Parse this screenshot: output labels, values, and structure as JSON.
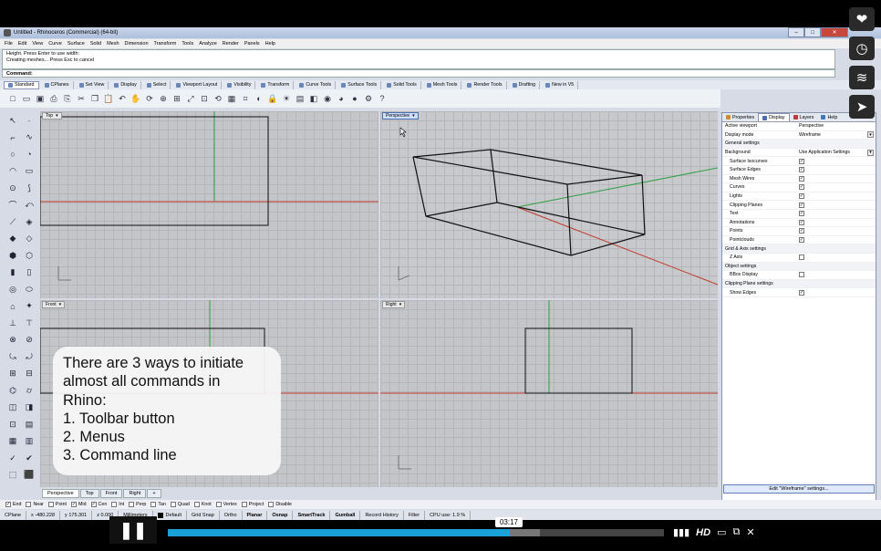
{
  "window": {
    "title": "Untitled - Rhinoceros (Commercial) (64-bit)",
    "buttons": [
      "–",
      "□",
      "✕"
    ]
  },
  "menu": [
    "File",
    "Edit",
    "View",
    "Curve",
    "Surface",
    "Solid",
    "Mesh",
    "Dimension",
    "Transform",
    "Tools",
    "Analyze",
    "Render",
    "Panels",
    "Help"
  ],
  "command_history": [
    "Height. Press Enter to use width:",
    "Creating meshes... Press Esc to cancel"
  ],
  "command_prompt": "Command:",
  "toolbar_tabs": [
    {
      "label": "Standard",
      "active": true
    },
    {
      "label": "CPlanes"
    },
    {
      "label": "Set View"
    },
    {
      "label": "Display"
    },
    {
      "label": "Select"
    },
    {
      "label": "Viewport Layout"
    },
    {
      "label": "Visibility"
    },
    {
      "label": "Transform"
    },
    {
      "label": "Curve Tools"
    },
    {
      "label": "Surface Tools"
    },
    {
      "label": "Solid Tools"
    },
    {
      "label": "Mesh Tools"
    },
    {
      "label": "Render Tools"
    },
    {
      "label": "Drafting"
    },
    {
      "label": "New in V5"
    }
  ],
  "toolbar_icons": [
    "new-icon",
    "open-icon",
    "save-icon",
    "print-icon",
    "import-icon",
    "cut-icon",
    "copy-icon",
    "paste-icon",
    "undo-icon",
    "pan-icon",
    "rotate-icon",
    "zoom-icon",
    "zoom-window-icon",
    "zoom-extents-icon",
    "zoom-selected-icon",
    "redraw-icon",
    "four-viewports-icon",
    "cplane-icon",
    "hide-icon",
    "lock-icon",
    "light-icon",
    "layer-icon",
    "material-icon",
    "color-icon",
    "render-icon",
    "sphere-icon",
    "options-icon",
    "help-icon"
  ],
  "toolbar_glyphs": [
    "□",
    "▭",
    "▣",
    "⎙",
    "⎘",
    "✂",
    "❐",
    "📋",
    "↶",
    "✋",
    "⟳",
    "⊕",
    "⊞",
    "⤢",
    "⊡",
    "⟲",
    "▦",
    "⌗",
    "◐",
    "🔒",
    "☀",
    "▤",
    "◧",
    "◉",
    "◕",
    "●",
    "⚙",
    "?"
  ],
  "left_tool_glyphs": [
    "↖",
    "·",
    "⌐",
    "∿",
    "○",
    "◔",
    "◠",
    "▭",
    "⊙",
    "⟆",
    "⌒",
    "⤺",
    "⟋",
    "◈",
    "◆",
    "◇",
    "⬢",
    "⬡",
    "▮",
    "▯",
    "◎",
    "⬭",
    "⌂",
    "✦",
    "⊥",
    "⊤",
    "⊗",
    "⊘",
    "⤿",
    "⤾",
    "⊞",
    "⊟",
    "⌬",
    "⌭",
    "◫",
    "◨",
    "⊡",
    "▤",
    "▦",
    "▥",
    "✓",
    "✔",
    "⬚",
    "⬛"
  ],
  "viewports": {
    "top": {
      "label": "Top"
    },
    "perspective": {
      "label": "Perspective"
    },
    "front": {
      "label": "Front"
    },
    "right": {
      "label": "Right"
    }
  },
  "viewport_tabs": [
    "Perspective",
    "Top",
    "Front",
    "Right",
    "+"
  ],
  "panel": {
    "tabs": [
      "Properties",
      "Display",
      "Layers",
      "Help"
    ],
    "rows": [
      {
        "key": "Active viewport",
        "value": "Perspective"
      },
      {
        "key": "Display mode",
        "value": "Wireframe",
        "dropdown": true
      },
      {
        "key": "General settings",
        "section": true
      },
      {
        "key": "Background",
        "value": "Use Application Settings",
        "dropdown": true
      },
      {
        "key": "Surface Isocurves",
        "check": true,
        "sub": true
      },
      {
        "key": "Surface Edges",
        "check": true,
        "sub": true
      },
      {
        "key": "Mesh Wires",
        "check": true,
        "sub": true
      },
      {
        "key": "Curves",
        "check": true,
        "sub": true
      },
      {
        "key": "Lights",
        "check": true,
        "sub": true
      },
      {
        "key": "Clipping Planes",
        "check": true,
        "sub": true
      },
      {
        "key": "Text",
        "check": true,
        "sub": true
      },
      {
        "key": "Annotations",
        "check": true,
        "sub": true
      },
      {
        "key": "Points",
        "check": true,
        "sub": true
      },
      {
        "key": "Pointclouds",
        "check": true,
        "sub": true
      },
      {
        "key": "Grid & Axis settings",
        "section": true
      },
      {
        "key": "Z Axis",
        "check": false,
        "sub": true
      },
      {
        "key": "Object settings",
        "section": true
      },
      {
        "key": "BBox Display",
        "check": false,
        "sub": true
      },
      {
        "key": "Clipping Plane settings",
        "section": true
      },
      {
        "key": "Show Edges",
        "check": true,
        "sub": true
      }
    ],
    "edit_button": "Edit \"Wireframe\" settings..."
  },
  "osnaps": [
    {
      "label": "End",
      "checked": true
    },
    {
      "label": "Near",
      "checked": false
    },
    {
      "label": "Point",
      "checked": false
    },
    {
      "label": "Mid",
      "checked": true
    },
    {
      "label": "Cen",
      "checked": true
    },
    {
      "label": "Int",
      "checked": false
    },
    {
      "label": "Perp",
      "checked": false
    },
    {
      "label": "Tan",
      "checked": false
    },
    {
      "label": "Quad",
      "checked": false
    },
    {
      "label": "Knot",
      "checked": false
    },
    {
      "label": "Vertex",
      "checked": false
    },
    {
      "label": "Project",
      "checked": false
    },
    {
      "label": "Disable",
      "checked": false
    }
  ],
  "status": {
    "cplane": "CPlane",
    "x": "x -480.228",
    "y": "y 175.301",
    "z": "z 0.000",
    "units": "Millimeters",
    "layer": "Default",
    "toggles": [
      "Grid Snap",
      "Ortho",
      "Planar",
      "Osnap",
      "SmartTrack",
      "Gumball",
      "Record History",
      "Filter"
    ],
    "cpu": "CPU use: 1.9 %"
  },
  "caption": {
    "line1": "There are 3 ways to initiate",
    "line2": "almost all commands in",
    "line3": "Rhino:",
    "line4": "1. Toolbar button",
    "line5": "2. Menus",
    "line6": "3. Command line"
  },
  "player": {
    "time": "03:17",
    "progress_fraction": 0.69,
    "buffered_fraction": 0.75,
    "hd_label": "HD",
    "side_icons": [
      "heart-icon",
      "clock-icon",
      "layers-icon",
      "send-icon"
    ],
    "side_glyphs": [
      "❤",
      "◷",
      "≋",
      "➤"
    ]
  },
  "colors": {
    "viewport_bg": "#c4c5c8",
    "axis_x": "#c0392b",
    "axis_y": "#2e9e44",
    "progress": "#1aa1d8"
  }
}
